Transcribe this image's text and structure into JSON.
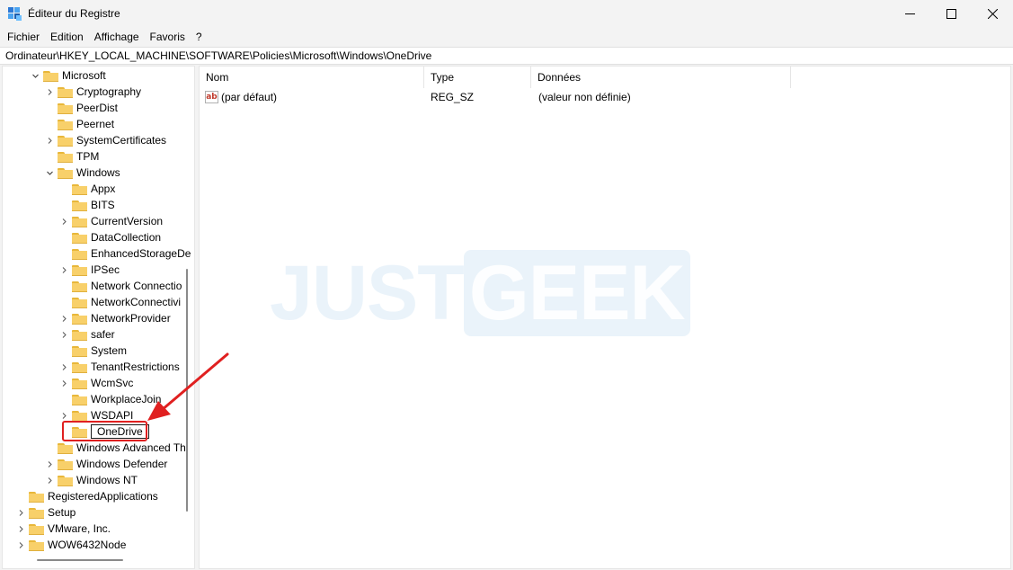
{
  "window": {
    "title": "Éditeur du Registre",
    "minimize_icon": "minimize-icon",
    "maximize_icon": "maximize-icon",
    "close_icon": "close-icon"
  },
  "menu": [
    "Fichier",
    "Edition",
    "Affichage",
    "Favoris",
    "?"
  ],
  "address": "Ordinateur\\HKEY_LOCAL_MACHINE\\SOFTWARE\\Policies\\Microsoft\\Windows\\OneDrive",
  "tree": [
    {
      "label": "Microsoft",
      "level": 1,
      "chevron": "down"
    },
    {
      "label": "Cryptography",
      "level": 2,
      "chevron": "right"
    },
    {
      "label": "PeerDist",
      "level": 2,
      "chevron": "none"
    },
    {
      "label": "Peernet",
      "level": 2,
      "chevron": "none"
    },
    {
      "label": "SystemCertificates",
      "level": 2,
      "chevron": "right"
    },
    {
      "label": "TPM",
      "level": 2,
      "chevron": "none"
    },
    {
      "label": "Windows",
      "level": 2,
      "chevron": "down"
    },
    {
      "label": "Appx",
      "level": 3,
      "chevron": "none"
    },
    {
      "label": "BITS",
      "level": 3,
      "chevron": "none"
    },
    {
      "label": "CurrentVersion",
      "level": 3,
      "chevron": "right"
    },
    {
      "label": "DataCollection",
      "level": 3,
      "chevron": "none"
    },
    {
      "label": "EnhancedStorageDe",
      "level": 3,
      "chevron": "none"
    },
    {
      "label": "IPSec",
      "level": 3,
      "chevron": "right"
    },
    {
      "label": "Network Connectio",
      "level": 3,
      "chevron": "none"
    },
    {
      "label": "NetworkConnectivi",
      "level": 3,
      "chevron": "none"
    },
    {
      "label": "NetworkProvider",
      "level": 3,
      "chevron": "right"
    },
    {
      "label": "safer",
      "level": 3,
      "chevron": "right"
    },
    {
      "label": "System",
      "level": 3,
      "chevron": "none"
    },
    {
      "label": "TenantRestrictions",
      "level": 3,
      "chevron": "right"
    },
    {
      "label": "WcmSvc",
      "level": 3,
      "chevron": "right"
    },
    {
      "label": "WorkplaceJoin",
      "level": 3,
      "chevron": "none"
    },
    {
      "label": "WSDAPI",
      "level": 3,
      "chevron": "right"
    },
    {
      "label": "OneDrive",
      "level": 3,
      "chevron": "none",
      "selected": true
    },
    {
      "label": "Windows Advanced Th",
      "level": 2,
      "chevron": "none"
    },
    {
      "label": "Windows Defender",
      "level": 2,
      "chevron": "right"
    },
    {
      "label": "Windows NT",
      "level": 2,
      "chevron": "right"
    },
    {
      "label": "RegisteredApplications",
      "level": 0,
      "chevron": "none"
    },
    {
      "label": "Setup",
      "level": 0,
      "chevron": "right"
    },
    {
      "label": "VMware, Inc.",
      "level": 0,
      "chevron": "right"
    },
    {
      "label": "WOW6432Node",
      "level": 0,
      "chevron": "right"
    }
  ],
  "columns": {
    "name": "Nom",
    "type": "Type",
    "data": "Données"
  },
  "values": [
    {
      "name": "(par défaut)",
      "type": "REG_SZ",
      "data": "(valeur non définie)",
      "icon": "string-value-icon"
    }
  ],
  "watermark": {
    "part1": "JUST",
    "part2": "GEEK"
  },
  "colors": {
    "folder": "#f8d06a",
    "highlight": "#e02020",
    "arrow": "#e02020"
  }
}
